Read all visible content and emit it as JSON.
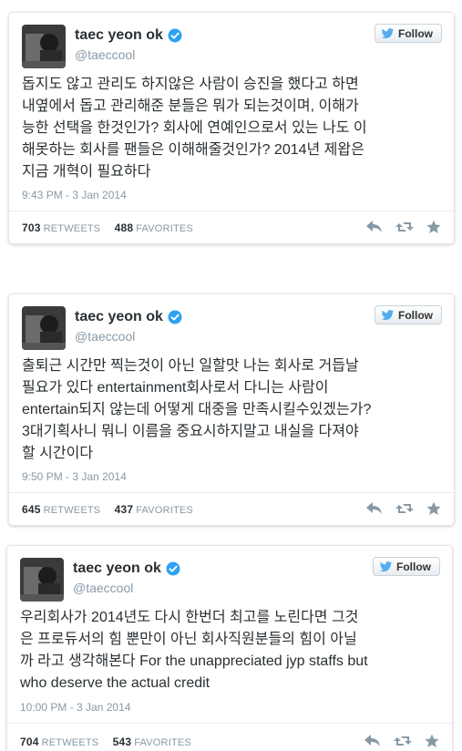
{
  "tweets": [
    {
      "name": "taec yeon ok",
      "handle": "@taeccool",
      "follow_label": "Follow",
      "text": "돕지도 않고 관리도 하지않은 사람이 승진을 했다고 하면\n내옆에서 돕고 관리해준 분들은 뭐가 되는것이며, 이해가\n능한 선택을 한것인가? 회사에 연예인으로서 있는 나도 이\n해못하는 회사를 팬들은 이해해줄것인가? 2014년 제왑은\n지금 개혁이 필요하다",
      "time": "9:43 PM - 3 Jan 2014",
      "retweets": "703",
      "retweets_label": "RETWEETS",
      "favorites": "488",
      "favorites_label": "FAVORITES"
    },
    {
      "name": "taec yeon ok",
      "handle": "@taeccool",
      "follow_label": "Follow",
      "text": "출퇴근 시간만 찍는것이 아닌 일할맛 나는 회사로 거듭날\n필요가 있다 entertainment회사로서 다니는 사람이\nentertain되지 않는데 어떻게 대중을 만족시킬수있겠는가?\n3대기획사니 뭐니 이름을 중요시하지말고 내실을 다져야\n할 시간이다",
      "time": "9:50 PM - 3 Jan 2014",
      "retweets": "645",
      "retweets_label": "RETWEETS",
      "favorites": "437",
      "favorites_label": "FAVORITES"
    },
    {
      "name": "taec yeon ok",
      "handle": "@taeccool",
      "follow_label": "Follow",
      "text": "우리회사가 2014년도 다시 한번더 최고를 노린다면 그것\n은 프로듀서의 힘 뿐만이 아닌 회사직원분들의 힘이 아닐\n까 라고 생각해본다 For the unappreciated jyp staffs but\nwho deserve the actual credit",
      "time": "10:00 PM - 3 Jan 2014",
      "retweets": "704",
      "retweets_label": "RETWEETS",
      "favorites": "543",
      "favorites_label": "FAVORITES"
    }
  ],
  "icons": {
    "verified": "verified-badge-icon",
    "follow": "twitter-bird-icon",
    "reply": "reply-icon",
    "retweet": "retweet-icon",
    "favorite": "star-icon"
  },
  "colors": {
    "verified_blue": "#2ea1f2",
    "bird_blue": "#55acee",
    "muted": "#8899a6",
    "action_gray": "#8899a6"
  }
}
